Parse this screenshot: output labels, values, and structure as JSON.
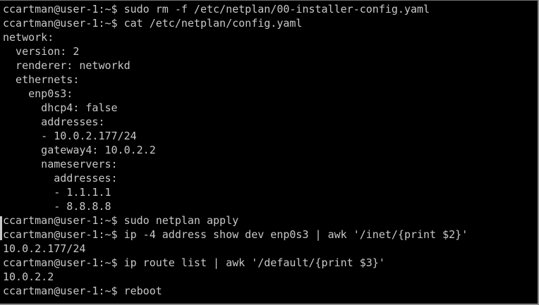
{
  "terminal": {
    "lines": [
      "ccartman@user-1:~$ sudo rm -f /etc/netplan/00-installer-config.yaml",
      "ccartman@user-1:~$ cat /etc/netplan/config.yaml",
      "network:",
      "  version: 2",
      "  renderer: networkd",
      "  ethernets:",
      "    enp0s3:",
      "      dhcp4: false",
      "      addresses:",
      "      - 10.0.2.177/24",
      "      gateway4: 10.0.2.2",
      "      nameservers:",
      "        addresses:",
      "        - 1.1.1.1",
      "        - 8.8.8.8",
      "ccartman@user-1:~$ sudo netplan apply",
      "ccartman@user-1:~$ ip -4 address show dev enp0s3 | awk '/inet/{print $2}'",
      "10.0.2.177/24",
      "ccartman@user-1:~$ ip route list | awk '/default/{print $3}'",
      "10.0.2.2",
      "ccartman@user-1:~$ reboot"
    ]
  },
  "colors": {
    "background": "#000000",
    "foreground": "#c8c8c8"
  }
}
